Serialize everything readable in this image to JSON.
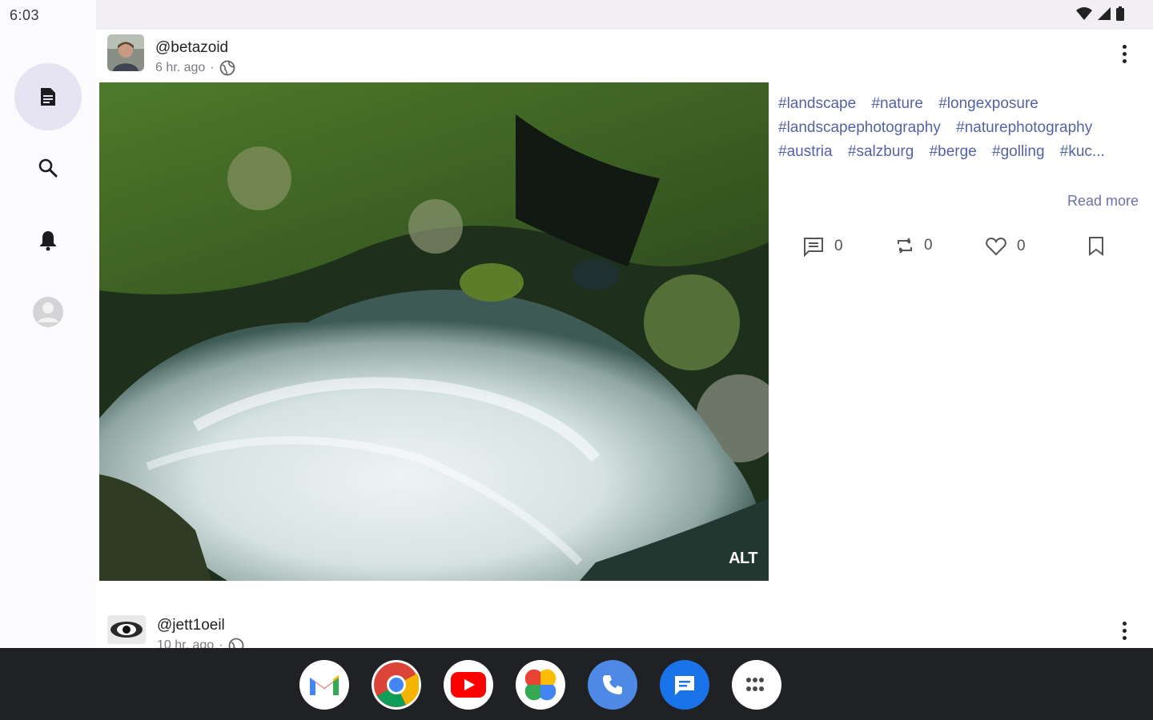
{
  "status_bar": {
    "time": "6:03"
  },
  "nav": {
    "items": [
      {
        "name": "feed",
        "icon": "feed-icon",
        "active": true
      },
      {
        "name": "search",
        "icon": "search-icon",
        "active": false
      },
      {
        "name": "notifications",
        "icon": "bell-icon",
        "active": false
      },
      {
        "name": "profile",
        "icon": "avatar-icon",
        "active": false
      }
    ]
  },
  "post1": {
    "username": "@betazoid",
    "time_ago": "6 hr. ago",
    "separator": "·",
    "visibility_icon": "globe-icon",
    "image_alt_badge": "ALT",
    "hashtags": [
      "#landscape",
      "#nature",
      "#longexposure",
      "#landscapephotography",
      "#naturephotography",
      "#austria",
      "#salzburg",
      "#berge",
      "#golling",
      "#kuc..."
    ],
    "read_more": "Read more",
    "counts": {
      "replies": "0",
      "boosts": "0",
      "favourites": "0"
    }
  },
  "post2": {
    "username": "@jett1oeil",
    "time_ago": "10 hr. ago",
    "separator": "·"
  },
  "dock": {
    "apps": [
      "gmail-icon",
      "chrome-icon",
      "youtube-icon",
      "photos-icon",
      "phone-icon",
      "messages-icon",
      "app-drawer-icon"
    ]
  },
  "colors": {
    "accent": "#5563a5",
    "nav_active": "#e6e3f2",
    "taskbar": "#202124"
  }
}
